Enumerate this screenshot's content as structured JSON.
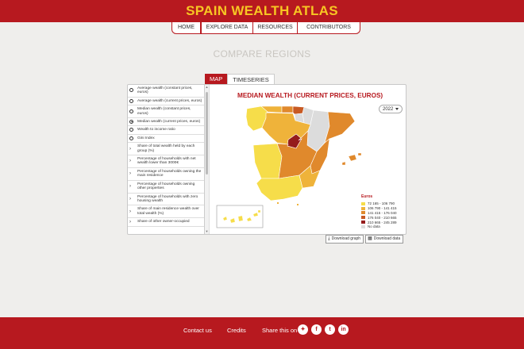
{
  "header": {
    "title": "SPAIN WEALTH ATLAS"
  },
  "nav": [
    {
      "label": "HOME"
    },
    {
      "label": "EXPLORE DATA"
    },
    {
      "label": "RESOURCES"
    },
    {
      "label": "CONTRIBUTORS"
    }
  ],
  "page_title": "COMPARE REGIONS",
  "tabs": [
    {
      "label": "MAP"
    },
    {
      "label": "TIMESERIES"
    }
  ],
  "indicators": [
    {
      "label": "Average wealth (constant prices, euros)",
      "control": "radio",
      "selected": false
    },
    {
      "label": "Average wealth (current prices, euros)",
      "control": "radio",
      "selected": false
    },
    {
      "label": "Median wealth (constant prices, euros)",
      "control": "radio",
      "selected": false
    },
    {
      "label": "Median wealth (current prices, euros)",
      "control": "radio",
      "selected": true
    },
    {
      "label": "Wealth to income ratio",
      "control": "radio",
      "selected": false
    },
    {
      "label": "Gini Index",
      "control": "radio",
      "selected": false
    },
    {
      "label": "Share of total wealth held by each group (%)",
      "control": "expand",
      "selected": false
    },
    {
      "label": "Percentage of households with net wealth lower than 3000€",
      "control": "expand",
      "selected": false
    },
    {
      "label": "Percentage of households owning the main residence",
      "control": "expand",
      "selected": false
    },
    {
      "label": "Percentage of households owning other properties",
      "control": "expand",
      "selected": false
    },
    {
      "label": "Percentage of households with zero housing wealth",
      "control": "expand",
      "selected": false
    },
    {
      "label": "Share of main residence wealth over total wealth (%)",
      "control": "expand",
      "selected": false
    },
    {
      "label": "Share of other owner-occupied",
      "control": "expand",
      "selected": false
    }
  ],
  "map": {
    "title": "MEDIAN WEALTH (CURRENT PRICES, EUROS)",
    "year": "2022",
    "legend": {
      "title": "Euros",
      "items": [
        {
          "label": "72 165 - 106 790",
          "color": "#f6dd4a"
        },
        {
          "label": "106 790 - 141 415",
          "color": "#efb33a"
        },
        {
          "label": "141 415 - 176 040",
          "color": "#e0892c"
        },
        {
          "label": "176 040 - 210 665",
          "color": "#c85a23"
        },
        {
          "label": "210 665 - 245 289",
          "color": "#951c1c"
        },
        {
          "label": "No data",
          "color": "#dcdcdc"
        }
      ]
    }
  },
  "downloads": {
    "graph_label": "Download graph",
    "data_label": "Download data"
  },
  "footer": {
    "contact": "Contact us",
    "credits": "Credits",
    "share": "Share this on"
  },
  "colors": {
    "brand_red": "#b7191f",
    "title_yellow": "#f7c623"
  }
}
